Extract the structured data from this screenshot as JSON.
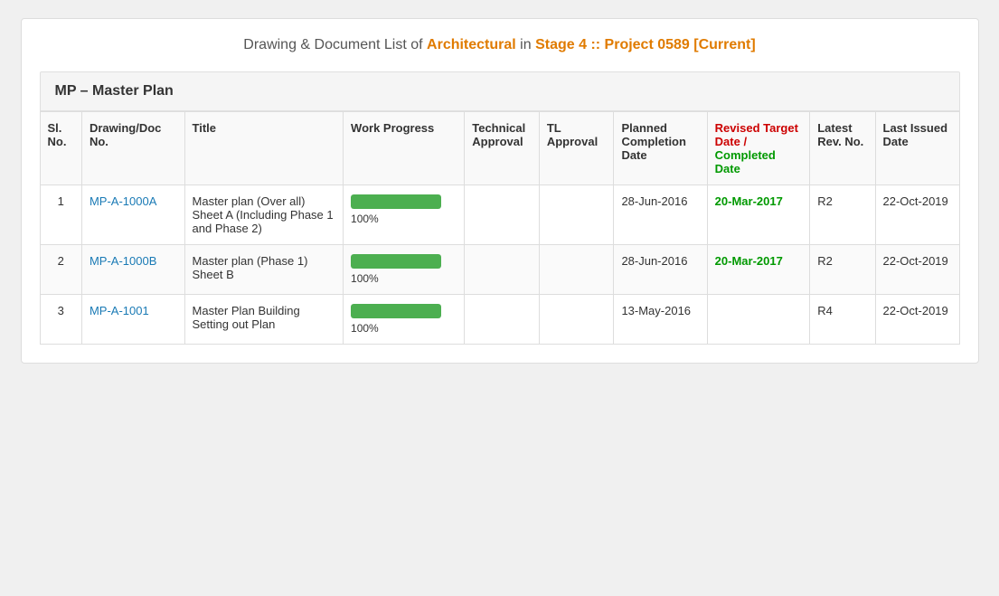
{
  "header": {
    "title_prefix": "Drawing & Document List of ",
    "arch": "Architectural",
    "title_mid": " in ",
    "stage": "Stage 4 :: Project 0589 [Current]"
  },
  "section": {
    "title": "MP – Master Plan"
  },
  "columns": {
    "sl_no": "Sl. No.",
    "doc_no": "Drawing/Doc No.",
    "title": "Title",
    "work_progress": "Work Progress",
    "tech_approval": "Technical Approval",
    "tl_approval": "TL Approval",
    "planned_completion": "Planned Completion Date",
    "revised_target": "Revised Target Date /",
    "revised_completed": "Completed Date",
    "latest_rev": "Latest Rev. No.",
    "last_issued": "Last Issued Date"
  },
  "rows": [
    {
      "sl_no": "1",
      "doc_no": "MP-A-1000A",
      "title": "Master plan (Over all) Sheet A (Including Phase 1 and Phase 2)",
      "work_progress_pct": 100,
      "tech_approval": "",
      "tl_approval": "",
      "planned_completion": "28-Jun-2016",
      "revised_target": "20-Mar-2017",
      "latest_rev": "R2",
      "last_issued": "22-Oct-2019"
    },
    {
      "sl_no": "2",
      "doc_no": "MP-A-1000B",
      "title": "Master plan (Phase 1) Sheet B",
      "work_progress_pct": 100,
      "tech_approval": "",
      "tl_approval": "",
      "planned_completion": "28-Jun-2016",
      "revised_target": "20-Mar-2017",
      "latest_rev": "R2",
      "last_issued": "22-Oct-2019"
    },
    {
      "sl_no": "3",
      "doc_no": "MP-A-1001",
      "title": "Master Plan Building Setting out Plan",
      "work_progress_pct": 100,
      "tech_approval": "",
      "tl_approval": "",
      "planned_completion": "13-May-2016",
      "revised_target": "",
      "latest_rev": "R4",
      "last_issued": "22-Oct-2019"
    }
  ]
}
